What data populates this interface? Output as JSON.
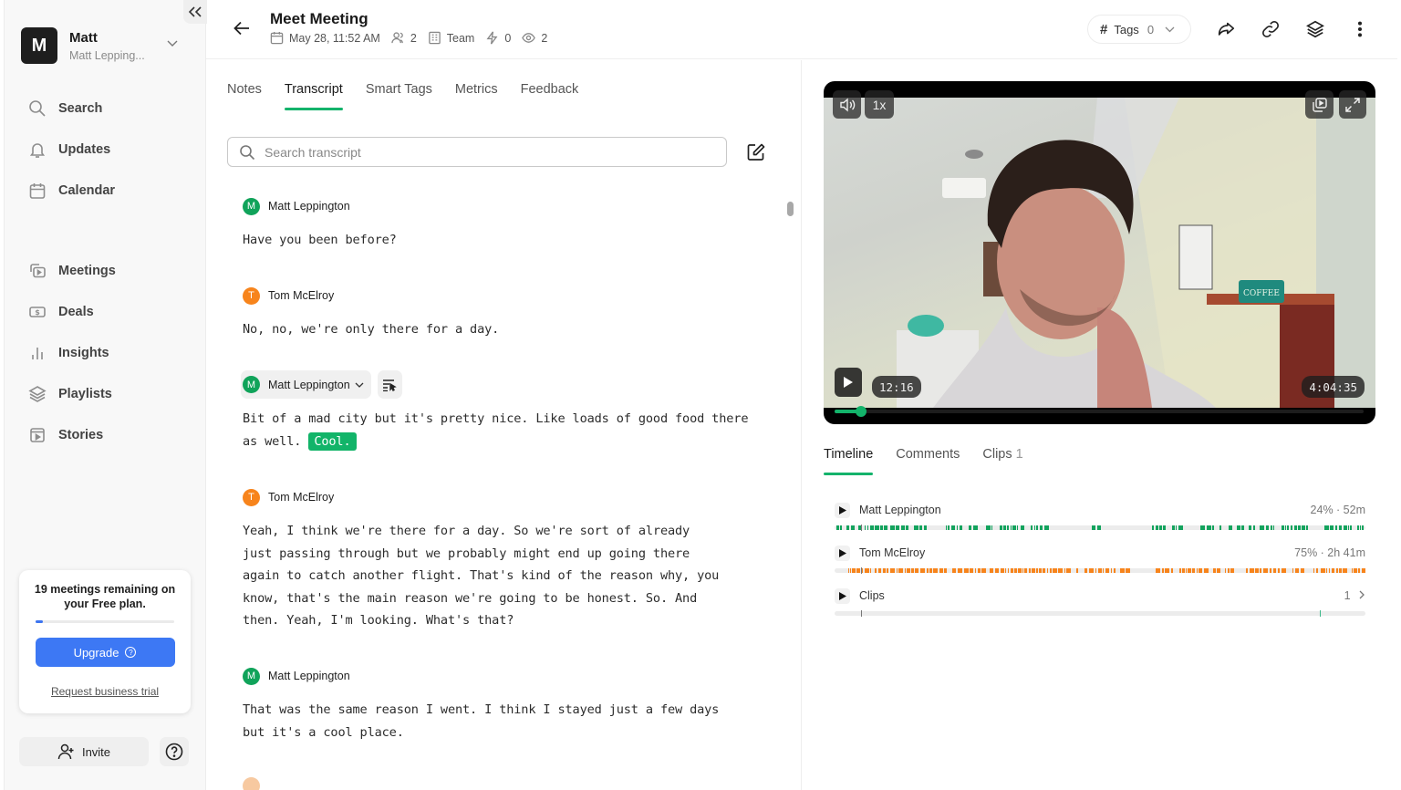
{
  "sidebar": {
    "collapse_icon": "double-chevron-left-icon",
    "user": {
      "initial": "M",
      "name": "Matt",
      "subtitle": "Matt Lepping..."
    },
    "nav_top": [
      {
        "label": "Search",
        "icon": "search-icon"
      },
      {
        "label": "Updates",
        "icon": "bell-icon"
      },
      {
        "label": "Calendar",
        "icon": "calendar-icon"
      }
    ],
    "nav_main": [
      {
        "label": "Meetings",
        "icon": "meetings-icon"
      },
      {
        "label": "Deals",
        "icon": "dollar-icon"
      },
      {
        "label": "Insights",
        "icon": "bar-chart-icon"
      },
      {
        "label": "Playlists",
        "icon": "layers-icon"
      },
      {
        "label": "Stories",
        "icon": "story-icon"
      }
    ],
    "plan": {
      "text": "19 meetings remaining on your Free plan.",
      "usage_fraction": 0.05,
      "upgrade_label": "Upgrade",
      "trial_link": "Request business trial"
    },
    "invite_label": "Invite"
  },
  "header": {
    "title": "Meet Meeting",
    "date": "May 28, 11:52 AM",
    "participants": "2",
    "workspace": "Team",
    "actions_count": "0",
    "views": "2",
    "tags_label": "Tags",
    "tags_count": "0"
  },
  "transcript": {
    "tabs": [
      "Notes",
      "Transcript",
      "Smart Tags",
      "Metrics",
      "Feedback"
    ],
    "active_tab": "Transcript",
    "search_placeholder": "Search transcript",
    "segments": [
      {
        "speaker": "Matt Leppington",
        "initial": "M",
        "text": "Have you been before?"
      },
      {
        "speaker": "Tom McElroy",
        "initial": "T",
        "text": "No, no, we're only there for a day."
      },
      {
        "speaker": "Matt Leppington",
        "initial": "M",
        "text": "Bit of a mad city but it's pretty nice. Like loads of good food there as well.",
        "highlight": "Cool."
      },
      {
        "speaker": "Tom McElroy",
        "initial": "T",
        "text": "Yeah, I think we're there for a day. So we're sort of already just passing through but we probably might end up going there again to catch another flight. That's kind of the reason why, you know, that's the main reason we're going to be honest. So. And then. Yeah, I'm looking. What's that?"
      },
      {
        "speaker": "Matt Leppington",
        "initial": "M",
        "text": "That was the same reason I went. I think I stayed just a few days but it's a cool place."
      }
    ]
  },
  "video": {
    "speed": "1x",
    "current_time": "12:16",
    "duration": "4:04:35",
    "progress_fraction": 0.05
  },
  "timeline": {
    "tabs": [
      {
        "label": "Timeline",
        "count": ""
      },
      {
        "label": "Comments",
        "count": ""
      },
      {
        "label": "Clips",
        "count": "1"
      }
    ],
    "active_tab": "Timeline",
    "tracks": [
      {
        "name": "Matt Leppington",
        "stat": "24% · 52m",
        "color": "#13a35d"
      },
      {
        "name": "Tom McElroy",
        "stat": "75% · 2h 41m",
        "color": "#f7841c"
      },
      {
        "name": "Clips",
        "stat": "1",
        "color": "#13a35d"
      }
    ]
  },
  "colors": {
    "accent": "#14b36b",
    "primary_button": "#3d78f4",
    "speaker_a": "#10a35a",
    "speaker_b": "#f7841c"
  }
}
